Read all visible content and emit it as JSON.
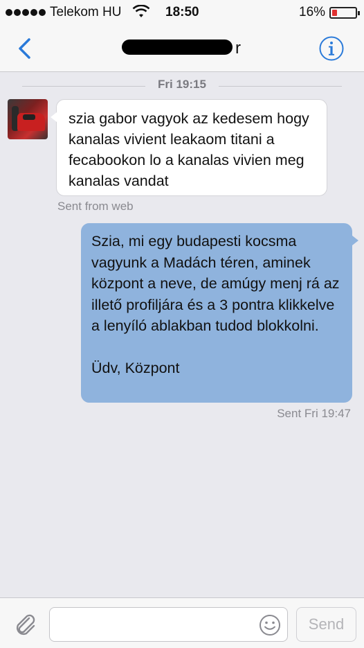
{
  "status_bar": {
    "carrier": "Telekom HU",
    "time": "18:50",
    "battery_percent": "16%",
    "battery_level": 0.16,
    "battery_color": "#e03030"
  },
  "nav": {
    "contact_name_tail": "r",
    "back_icon": "chevron-left-icon",
    "info_icon": "info-circle-icon",
    "accent": "#2a7ad9"
  },
  "conversation": {
    "timestamp": "Fri 19:15",
    "incoming": {
      "text": "szia gabor vagyok az kedesem hogy kanalas vivient leakaom titani a fecabookon lo a kanalas vivien meg kanalas vandat",
      "source": "Sent from web"
    },
    "outgoing": {
      "text": "Szia, mi egy budapesti kocsma vagyunk a Madách téren, aminek központ a neve, de amúgy menj rá az illető profiljára és a 3 pontra klikkelve a lenyíló ablakban tudod blokkolni.\n\nÜdv, Központ",
      "status": "Sent Fri 19:47",
      "bubble_color": "#8fb3dd"
    }
  },
  "compose": {
    "placeholder": "",
    "send_label": "Send",
    "attach_icon": "paperclip-icon",
    "emoji_icon": "smiley-icon"
  }
}
